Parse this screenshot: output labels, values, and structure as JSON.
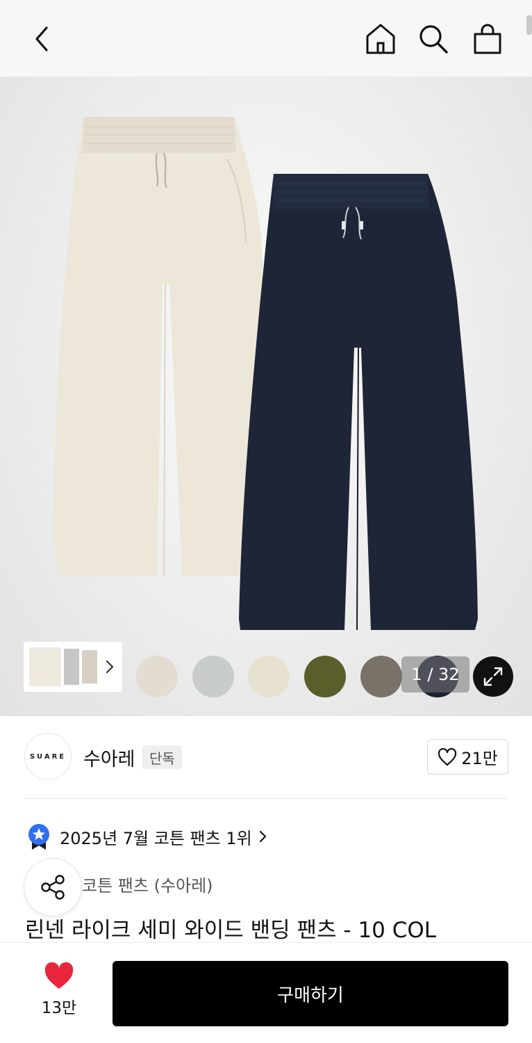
{
  "header": {
    "back_icon": "chevron-left-icon",
    "home_icon": "home-icon",
    "search_icon": "search-icon",
    "cart_icon": "shopping-bag-icon"
  },
  "gallery": {
    "counter": "1 / 32",
    "expand_icon": "expand-icon",
    "swatches": [
      "#e4dcd0",
      "#c8ccca",
      "#e7e1cf",
      "#5a5e2a",
      "#7a7268",
      "#1c2233",
      "#151515"
    ]
  },
  "brand": {
    "logo_text": "SUARE",
    "name": "수아레",
    "tag": "단독",
    "follow_count": "21만"
  },
  "ranking": {
    "text": "2025년 7월 코튼 팬츠 1위"
  },
  "product": {
    "category": "코튼 팬츠 (수아레)",
    "title": "린넨 라이크 세미 와이드 밴딩 팬츠 - 10 COL"
  },
  "bottom": {
    "like_count": "13만",
    "buy_label": "구매하기"
  },
  "colors": {
    "accent_red": "#e8253b",
    "rank_blue": "#2f6ff0",
    "buy_bg": "#000000"
  }
}
